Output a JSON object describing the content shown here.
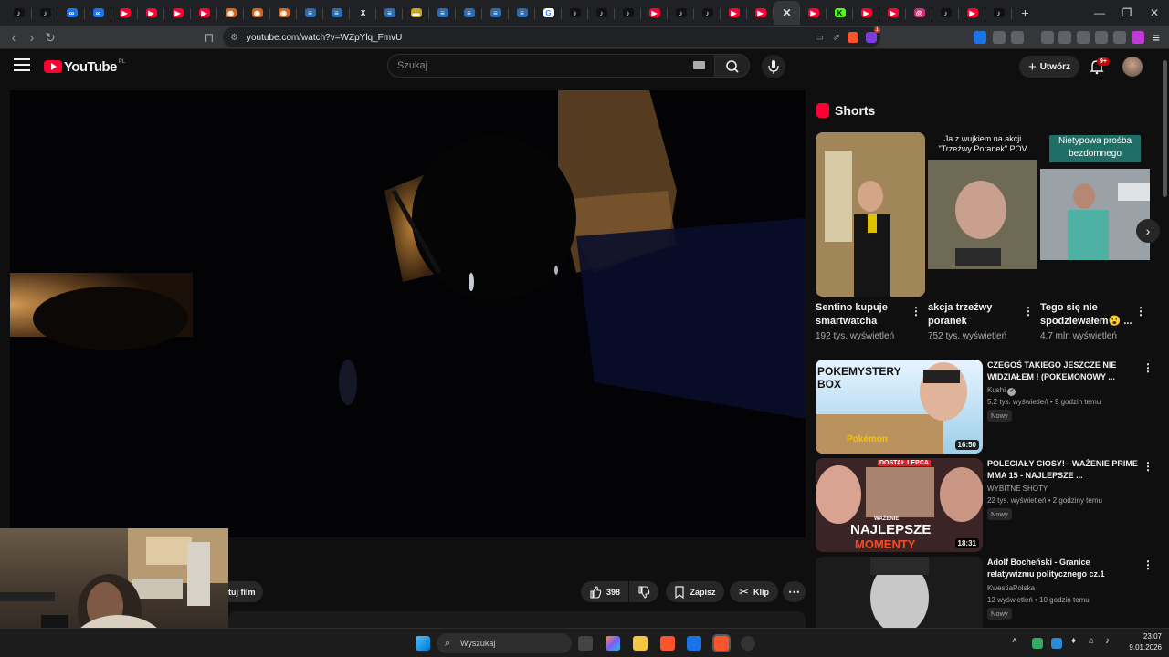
{
  "browser": {
    "tabs": [
      {
        "icon": "tiktok-icon",
        "color": "#111111",
        "glyph": "♪"
      },
      {
        "icon": "tiktok-icon",
        "color": "#111111",
        "glyph": "♪"
      },
      {
        "icon": "meet-icon",
        "color": "#1a73e8",
        "glyph": "∞"
      },
      {
        "icon": "meet-icon",
        "color": "#1a73e8",
        "glyph": "∞"
      },
      {
        "icon": "youtube-icon",
        "color": "#ff0033",
        "glyph": "▶"
      },
      {
        "icon": "youtube-icon",
        "color": "#ff0033",
        "glyph": "▶"
      },
      {
        "icon": "youtube-icon",
        "color": "#ff0033",
        "glyph": "▶"
      },
      {
        "icon": "youtube-icon",
        "color": "#ff0033",
        "glyph": "▶"
      },
      {
        "icon": "orange-icon",
        "color": "#d4651c",
        "glyph": "◉"
      },
      {
        "icon": "orange-icon",
        "color": "#d4651c",
        "glyph": "◉"
      },
      {
        "icon": "orange-icon",
        "color": "#d4651c",
        "glyph": "◉"
      },
      {
        "icon": "blue-stack-icon",
        "color": "#2b6cb0",
        "glyph": "≡"
      },
      {
        "icon": "blue-stack-icon",
        "color": "#2b6cb0",
        "glyph": "≡"
      },
      {
        "icon": "x-icon",
        "color": "#222222",
        "glyph": "X"
      },
      {
        "icon": "blue-stack-icon",
        "color": "#2b6cb0",
        "glyph": "≡"
      },
      {
        "icon": "flag-icon",
        "color": "#c9a227",
        "glyph": "▬"
      },
      {
        "icon": "blue-stack-icon",
        "color": "#2b6cb0",
        "glyph": "≡"
      },
      {
        "icon": "blue-stack-icon",
        "color": "#2b6cb0",
        "glyph": "≡"
      },
      {
        "icon": "blue-stack-icon",
        "color": "#2b6cb0",
        "glyph": "≡"
      },
      {
        "icon": "blue-stack-icon",
        "color": "#2b6cb0",
        "glyph": "≡"
      },
      {
        "icon": "google-icon",
        "color": "#ffffff",
        "glyph": "G"
      },
      {
        "icon": "tiktok-icon",
        "color": "#111111",
        "glyph": "♪"
      },
      {
        "icon": "tiktok-icon",
        "color": "#111111",
        "glyph": "♪"
      },
      {
        "icon": "tiktok-icon",
        "color": "#111111",
        "glyph": "♪"
      },
      {
        "icon": "youtube-icon",
        "color": "#ff0033",
        "glyph": "▶"
      },
      {
        "icon": "tiktok-icon",
        "color": "#111111",
        "glyph": "♪"
      },
      {
        "icon": "tiktok-icon",
        "color": "#111111",
        "glyph": "♪"
      },
      {
        "icon": "youtube-icon",
        "color": "#ff0033",
        "glyph": "▶"
      },
      {
        "icon": "youtube-icon",
        "color": "#ff0033",
        "glyph": "▶"
      },
      {
        "icon": "close-icon",
        "color": "#35363a",
        "glyph": "✕",
        "active": true
      },
      {
        "icon": "youtube-icon",
        "color": "#ff0033",
        "glyph": "▶"
      },
      {
        "icon": "kick-icon",
        "color": "#53fc18",
        "glyph": "K"
      },
      {
        "icon": "youtube-icon",
        "color": "#ff0033",
        "glyph": "▶"
      },
      {
        "icon": "youtube-icon",
        "color": "#ff0033",
        "glyph": "▶"
      },
      {
        "icon": "instagram-icon",
        "color": "#d62976",
        "glyph": "◎"
      },
      {
        "icon": "tiktok-icon",
        "color": "#111111",
        "glyph": "♪"
      },
      {
        "icon": "youtube-icon",
        "color": "#ff0033",
        "glyph": "▶"
      },
      {
        "icon": "tiktok-icon",
        "color": "#111111",
        "glyph": "♪"
      }
    ],
    "new_tab": "+",
    "url": "youtube.com/watch?v=WZpYlq_FmvU",
    "brave_badge": "1"
  },
  "youtube": {
    "logo_text": "YouTube",
    "country_code": "PL",
    "search_placeholder": "Szukaj",
    "create_label": "Utwórz",
    "notif_count": "9+"
  },
  "video": {
    "action_partial": "tuj film",
    "likes": "398",
    "save_label": "Zapisz",
    "clip_label": "Klip"
  },
  "shorts": {
    "heading": "Shorts",
    "items": [
      {
        "title": "Sentino kupuje smartwatcha",
        "views": "192 tys. wyświetleń",
        "overlay": ""
      },
      {
        "title": "akcja trzeźwy poranek",
        "views": "752 tys. wyświetleń",
        "overlay": "Ja z wujkiem na akcji \"Trzeźwy Poranek\" POV"
      },
      {
        "title": "Tego się nie spodziewałem😮 ...",
        "views": "4,7 mln wyświetleń",
        "overlay": "Nietypowa prośba bezdomnego"
      }
    ]
  },
  "videos": [
    {
      "title": "CZEGOŚ TAKIEGO JESZCZE NIE WIDZIAŁEM ! (POKEMONOWY ...",
      "channel": "Kushi",
      "verified": "✔",
      "meta": "5,2 tys. wyświetleń • 9 godzin temu",
      "badge": "Nowy",
      "duration": "16:50",
      "thumb_text": "POKEMYSTERY BOX",
      "thumb_sub": "Pokémon"
    },
    {
      "title": "POLECIAŁY CIOSY! - WAŻENIE PRIME MMA 15 - NAJLEPSZE ...",
      "channel": "WYBITNE SHOTY",
      "verified": "",
      "meta": "22 tys. wyświetleń • 2 godziny temu",
      "badge": "Nowy",
      "duration": "18:31",
      "thumb_text": "NAJLEPSZE",
      "thumb_sub": "MOMENTY",
      "thumb_top": "DOSTAŁ LEPCA",
      "thumb_small": "WAŻENIE"
    },
    {
      "title": "Adolf Bocheński -  Granice relatywizmu politycznego cz.1",
      "channel": "KwestiaPolska",
      "verified": "",
      "meta": "12 wyświetleń • 10 godzin temu",
      "badge": "Nowy",
      "duration": "",
      "thumb_text": "",
      "thumb_sub": ""
    }
  ],
  "taskbar": {
    "search_placeholder": "Wyszukaj",
    "time": "23:07",
    "date": "9.01.2026"
  }
}
